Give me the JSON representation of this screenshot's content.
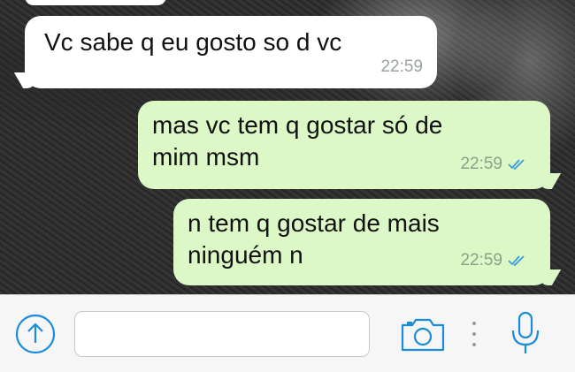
{
  "colors": {
    "incoming_bubble": "#ffffff",
    "outgoing_bubble": "#dcf8c6",
    "accent": "#1a8cd8",
    "read_ticks": "#3a9be0",
    "timestamp": "#9aa3a0"
  },
  "messages": [
    {
      "direction": "incoming",
      "text": "Vc sabe q eu gosto so d vc",
      "time": "22:59"
    },
    {
      "direction": "outgoing",
      "text": "mas vc tem q gostar só de\nmim msm",
      "time": "22:59",
      "status_icon": "double-check-read-icon"
    },
    {
      "direction": "outgoing",
      "text": "n tem q gostar de mais\nninguém n",
      "time": "22:59",
      "status_icon": "double-check-read-icon"
    }
  ],
  "input_bar": {
    "message_input_value": "",
    "share_icon": "upload-arrow-icon",
    "camera_icon": "camera-icon",
    "mic_icon": "microphone-icon"
  }
}
